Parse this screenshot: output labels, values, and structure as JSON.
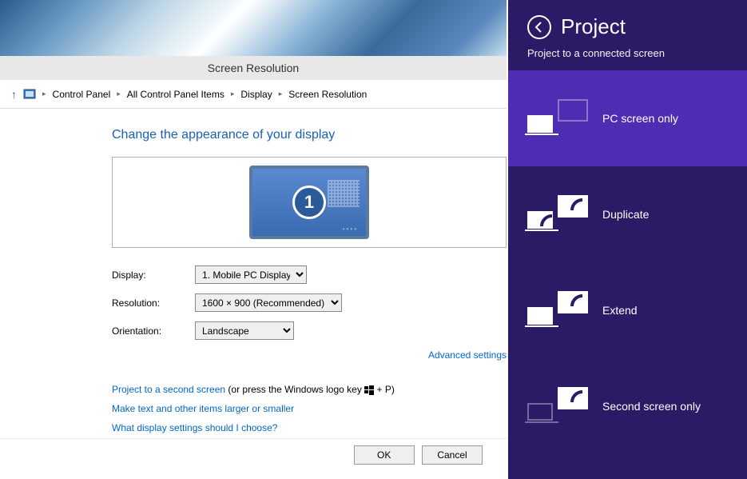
{
  "titlebar": "Screen Resolution",
  "breadcrumb": {
    "items": [
      "Control Panel",
      "All Control Panel Items",
      "Display",
      "Screen Resolution"
    ]
  },
  "heading": "Change the appearance of your display",
  "monitor_number": "1",
  "fields": {
    "display": {
      "label": "Display:",
      "value": "1. Mobile PC Display"
    },
    "resolution": {
      "label": "Resolution:",
      "value": "1600 × 900 (Recommended)"
    },
    "orientation": {
      "label": "Orientation:",
      "value": "Landscape"
    }
  },
  "advanced": "Advanced settings",
  "links": {
    "project": "Project to a second screen",
    "project_suffix_1": " (or press the Windows logo key ",
    "project_suffix_2": " + P)",
    "size": "Make text and other items larger or smaller",
    "help": "What display settings should I choose?"
  },
  "buttons": {
    "ok": "OK",
    "cancel": "Cancel"
  },
  "charm": {
    "title": "Project",
    "subtitle": "Project to a connected screen",
    "options": [
      {
        "label": "PC screen only"
      },
      {
        "label": "Duplicate"
      },
      {
        "label": "Extend"
      },
      {
        "label": "Second screen only"
      }
    ]
  }
}
